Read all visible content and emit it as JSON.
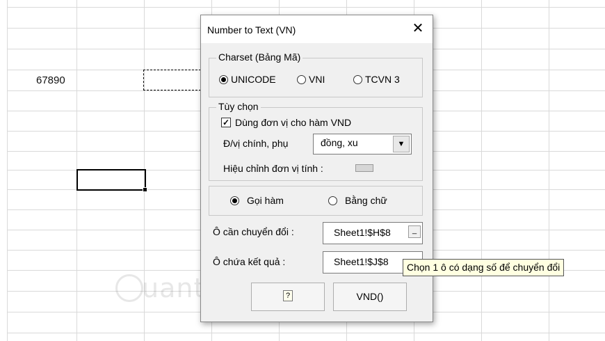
{
  "sheet": {
    "cell_value": "67890"
  },
  "dialog": {
    "title": "Number to Text (VN)",
    "close_glyph": "✕",
    "charset": {
      "legend": "Charset (Bảng Mã)",
      "options": [
        {
          "label": "UNICODE",
          "selected": true
        },
        {
          "label": "VNI",
          "selected": false
        },
        {
          "label": "TCVN 3",
          "selected": false
        }
      ]
    },
    "options_group": {
      "legend": "Tùy chọn",
      "use_unit_label": "Dùng đơn vị cho hàm VND",
      "use_unit_checked": true,
      "unit_label": "Đ/vị chính, phụ",
      "unit_value": "đồng, xu",
      "adjust_label": "Hiệu chỉnh đơn vị tính :"
    },
    "mode": {
      "options": [
        {
          "label": "Gọi hàm",
          "selected": true
        },
        {
          "label": "Bằng chữ",
          "selected": false
        }
      ]
    },
    "source": {
      "label": "Ô cần chuyển đổi :",
      "value": "Sheet1!$H$8"
    },
    "target": {
      "label": "Ô chứa kết quả :",
      "value": "Sheet1!$J$8"
    },
    "buttons": {
      "help_icon": "?",
      "vnd_label": "VND()"
    }
  },
  "tooltip": {
    "text": "Chọn 1 ô có dạng số để chuyển đổi"
  },
  "watermark": {
    "text": "uantrimang"
  }
}
